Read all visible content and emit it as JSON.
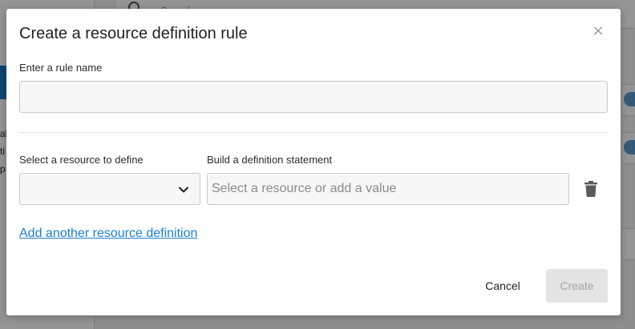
{
  "background": {
    "search_placeholder": "Search"
  },
  "dialog": {
    "title": "Create a resource definition rule",
    "close_icon": "close-icon",
    "close_glyph": "×",
    "rule_name": {
      "label": "Enter a rule name",
      "value": ""
    },
    "definition": {
      "resource_label": "Select a resource to define",
      "resource_value": "",
      "statement_label": "Build a definition statement",
      "statement_placeholder": "Select a resource or add a value",
      "statement_value": "",
      "delete_icon": "trash-icon"
    },
    "add_link": "Add another resource definition",
    "cancel_label": "Cancel",
    "create_label": "Create"
  },
  "colors": {
    "link": "#1a7fd4",
    "disabled_button_bg": "#e4e4e4",
    "disabled_button_text": "#a5a5a5",
    "overlay": "rgba(0,0,0,0.42)"
  }
}
